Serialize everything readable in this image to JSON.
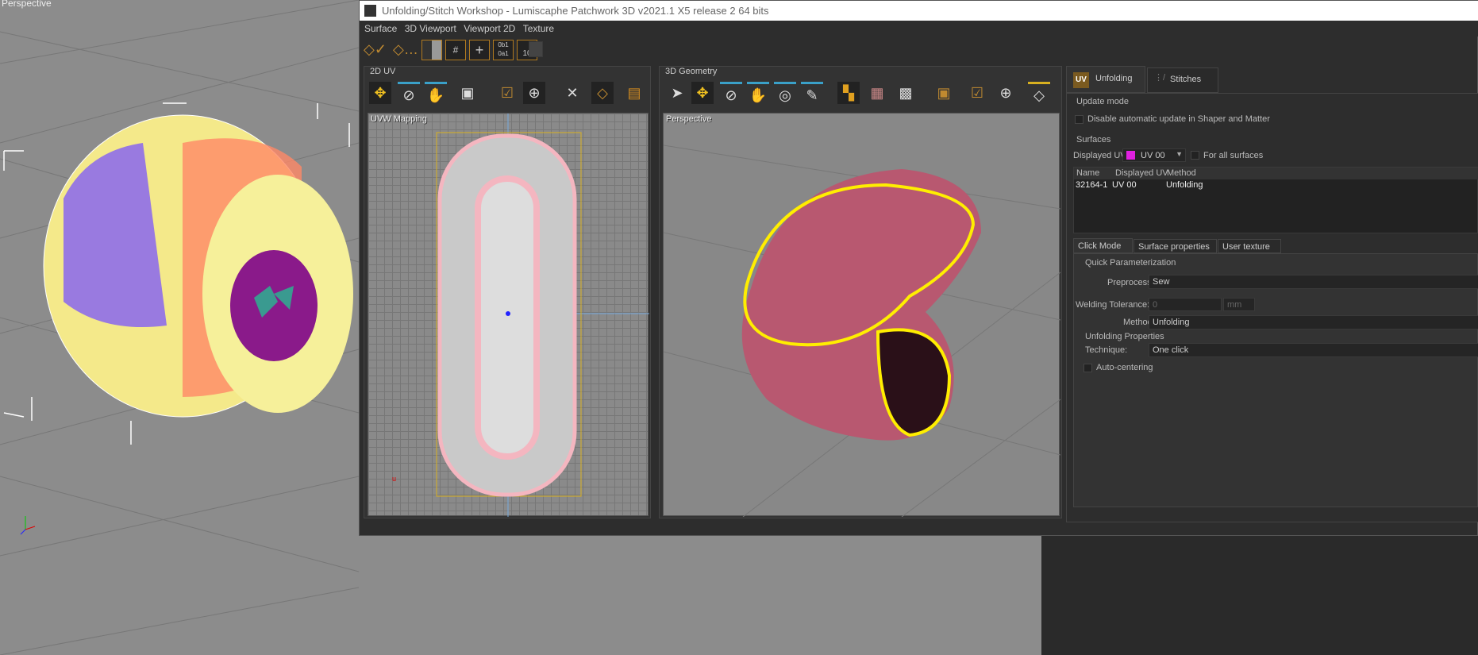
{
  "background_viewport": {
    "label": "Perspective"
  },
  "window": {
    "title": "Unfolding/Stitch Workshop - Lumiscaphe Patchwork 3D v2021.1 X5 release 2 64 bits",
    "menu": [
      "Surface",
      "3D Viewport",
      "Viewport 2D",
      "Texture"
    ],
    "toolbar_icons": [
      "unfold-apply-icon",
      "unfold-options-icon",
      "checker-icon",
      "grid-icon",
      "cross-icon",
      "binary-icon",
      "ruler-10-icon",
      "user-icon"
    ],
    "toolbar_texts": {
      "binary": "0b1 0a1",
      "ruler": "10"
    },
    "panel_2d": {
      "title": "2D UV",
      "viewport_label": "UVW Mapping",
      "axis_u": "u"
    },
    "panel_3d": {
      "title": "3D Geometry",
      "viewport_label": "Perspective"
    },
    "right_panel": {
      "tabs": [
        {
          "label": "Unfolding",
          "icon_text": "UV",
          "active": true
        },
        {
          "label": "Stitches",
          "active": false
        }
      ],
      "update_mode": {
        "title": "Update mode",
        "checkbox_label": "Disable automatic update in Shaper and Matter",
        "checked": false
      },
      "surfaces": {
        "title": "Surfaces",
        "displayed_uv_label": "Displayed UV:",
        "displayed_uv_value": "UV 00",
        "for_all_label": "For all surfaces",
        "columns": [
          "Name",
          "Displayed UV",
          "Method"
        ],
        "rows": [
          [
            "32164-1",
            "UV 00",
            "Unfolding"
          ]
        ]
      },
      "bottom_tabs": [
        "Click Mode",
        "Surface properties",
        "User texture"
      ],
      "quick_param": {
        "title": "Quick Parameterization",
        "preprocess_label": "Preprocess:",
        "preprocess_value": "Sew",
        "welding_label": "Welding Tolerance:",
        "welding_value": "0",
        "welding_unit": "mm",
        "method_label": "Method:",
        "method_value": "Unfolding",
        "unfolding_props_title": "Unfolding Properties",
        "technique_label": "Technique:",
        "technique_value": "One click",
        "auto_centering_label": "Auto-centering",
        "auto_centering_checked": false
      }
    }
  },
  "colors": {
    "accent": "#e0a020",
    "highlight_blue": "#3aa0c8",
    "mesh_pink": "#f4b6c0",
    "model_pink": "#b85870",
    "yellow_seam": "#ffee00"
  }
}
